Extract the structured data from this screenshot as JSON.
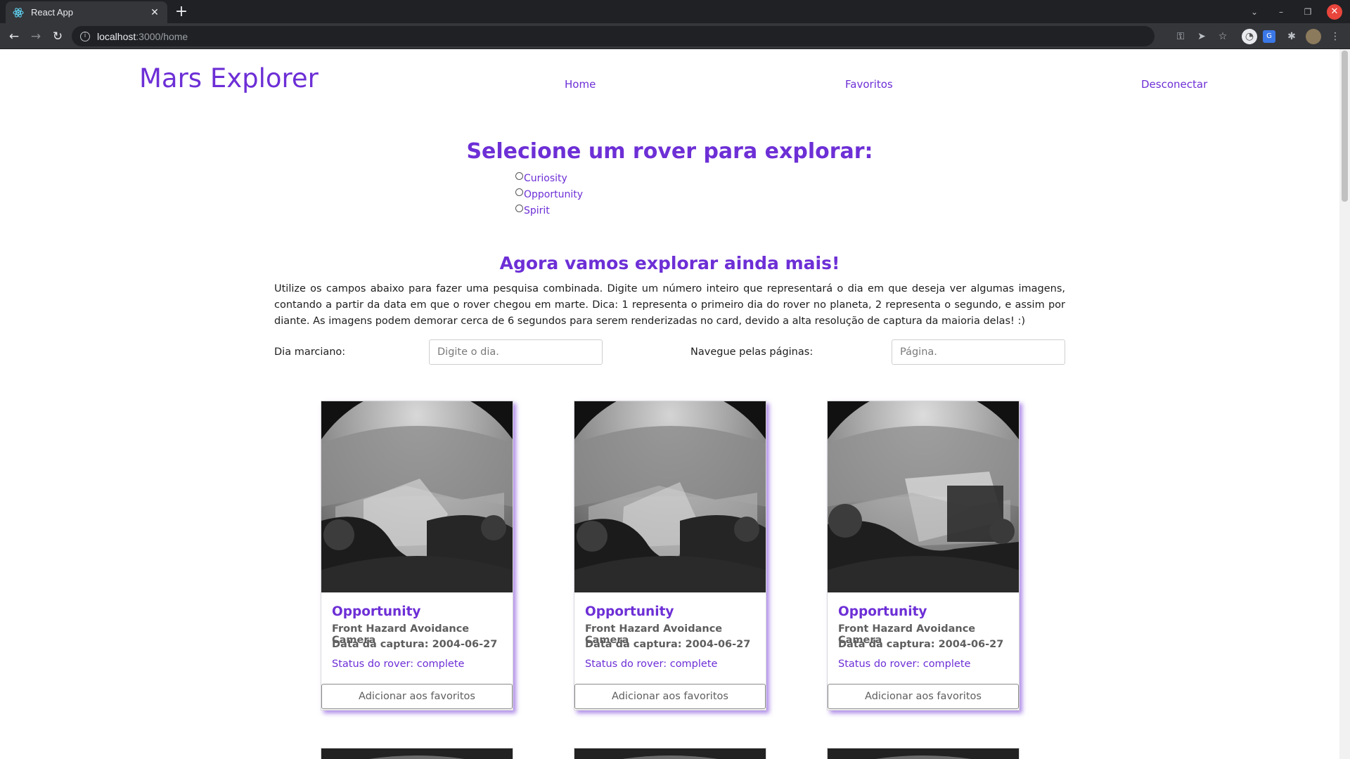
{
  "browser": {
    "tab_title": "React App",
    "new_tab_symbol": "+",
    "url_host": "localhost",
    "url_path": ":3000/home",
    "icons": [
      "react-favicon",
      "close-icon",
      "back-icon",
      "forward-icon",
      "reload-icon",
      "info-icon",
      "key-icon",
      "send-icon",
      "star-icon",
      "extension-icon",
      "puzzle-icon",
      "profile-avatar",
      "menu-icon"
    ]
  },
  "header": {
    "brand": "Mars Explorer",
    "nav": {
      "home": "Home",
      "favorites": "Favoritos",
      "logout": "Desconectar"
    }
  },
  "rover_select": {
    "heading": "Selecione um rover para explorar:",
    "options": [
      "Curiosity",
      "Opportunity",
      "Spirit"
    ]
  },
  "explore": {
    "heading": "Agora vamos explorar ainda mais!",
    "intro": "Utilize os campos abaixo para fazer uma pesquisa combinada. Digite um número inteiro que representará o dia em que deseja ver algumas imagens, contando a partir da data em que o rover chegou em marte. Dica: 1 representa o primeiro dia do rover no planeta, 2 representa o segundo, e assim por diante. As imagens podem demorar cerca de 6 segundos para serem renderizadas no card, devido a alta resolução de captura da maioria delas! :)",
    "sol_label": "Dia marciano:",
    "sol_placeholder": "Digite o dia.",
    "page_label": "Navegue pelas páginas:",
    "page_placeholder": "Página."
  },
  "cards": [
    {
      "rover": "Opportunity",
      "camera": "Front Hazard Avoidance Camera",
      "date": "Data da captura: 2004-06-27",
      "status": "Status do rover: complete",
      "button": "Adicionar aos favoritos"
    },
    {
      "rover": "Opportunity",
      "camera": "Front Hazard Avoidance Camera",
      "date": "Data da captura: 2004-06-27",
      "status": "Status do rover: complete",
      "button": "Adicionar aos favoritos"
    },
    {
      "rover": "Opportunity",
      "camera": "Front Hazard Avoidance Camera",
      "date": "Data da captura: 2004-06-27",
      "status": "Status do rover: complete",
      "button": "Adicionar aos favoritos"
    }
  ],
  "colors": {
    "accent": "#6d2fd6",
    "chrome_dark": "#202124",
    "chrome_mid": "#35363a"
  }
}
